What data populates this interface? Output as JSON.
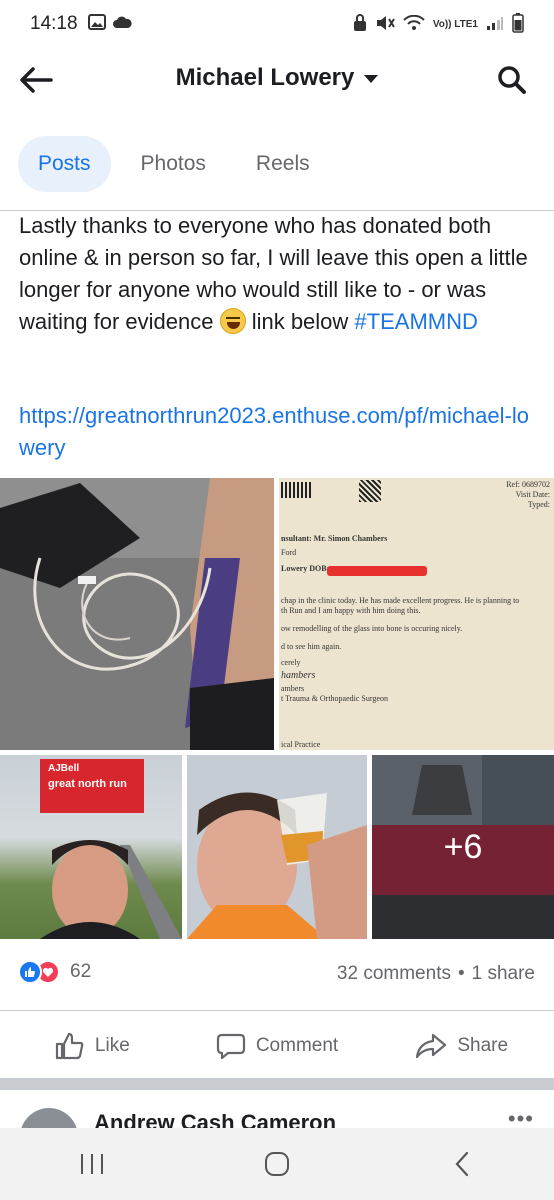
{
  "status_bar": {
    "time": "14:18",
    "network_label": "Vo)) LTE1"
  },
  "header": {
    "title": "Michael Lowery"
  },
  "tabs": [
    {
      "label": "Posts",
      "active": true
    },
    {
      "label": "Photos",
      "active": false
    },
    {
      "label": "Reels",
      "active": false
    }
  ],
  "post": {
    "text_before_emoji": "Lastly thanks to everyone who has donated both online & in person so far, I will leave this open a little longer for anyone who would still like to - or was waiting for evidence",
    "text_after_emoji": " link below ",
    "hashtag": "#TEAMMND",
    "link": "https://greatnorthrun2023.enthuse.com/pf/michael-lowery",
    "emoji": "grinning-squinting-face",
    "more_photos_label": "+6",
    "reaction_count": "62",
    "comments": "32 comments",
    "dot": "•",
    "shares": "1 share"
  },
  "letter": {
    "ref": "Ref: 0689702",
    "visit_date": "Visit Date:",
    "typed": "Typed:",
    "consultant": "nsultant: Mr. Simon Chambers",
    "ford": "Ford",
    "lowery": "Lowery    DOB:",
    "line1": "chap in the clinic today.  He has made excellent progress.  He is planning to",
    "line2": "th Run and I am happy with him doing this.",
    "line3": "ow remodelling of the glass into bone is occuring nicely.",
    "line4": "d to see him again.",
    "sincerely": "cerely",
    "sign": "hambers",
    "name": "ambers",
    "dept": "t Trauma & Orthopaedic Surgeon",
    "practice": "ical Practice"
  },
  "sign_text": {
    "brand": "AJBell",
    "run": "great north run"
  },
  "actions": {
    "like": "Like",
    "comment": "Comment",
    "share": "Share"
  },
  "next_post": {
    "author": "Andrew Cash Cameron",
    "more": "•••"
  },
  "colors": {
    "accent": "#1b74e4",
    "like_blue": "#1877f2",
    "love_red": "#f33e58",
    "muted": "#65676b"
  }
}
